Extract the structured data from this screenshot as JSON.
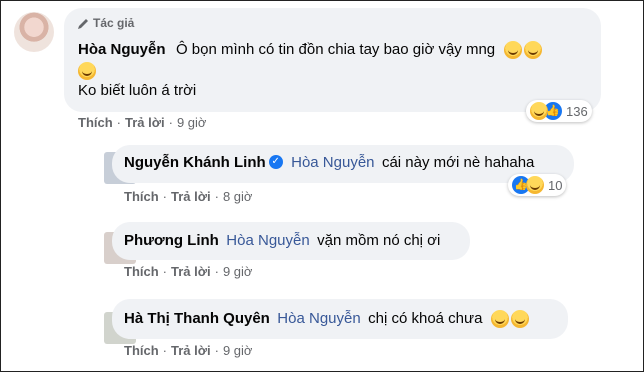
{
  "main_comment": {
    "badge": "Tác giả",
    "author": "Hòa Nguyễn",
    "text_line1": "Ô bọn mình có tin đồn chia tay bao giờ vậy mng",
    "text_line2": "Ko biết luôn á trời",
    "reaction_count": "136",
    "actions": {
      "like": "Thích",
      "reply": "Trả lời",
      "time": "9 giờ"
    }
  },
  "replies": [
    {
      "author": "Nguyễn Khánh Linh",
      "verified": true,
      "mention": "Hòa Nguyễn",
      "text": "cái này mới nè hahaha",
      "reaction_count": "10",
      "actions": {
        "like": "Thích",
        "reply": "Trả lời",
        "time": "8 giờ"
      }
    },
    {
      "author": "Phương Linh",
      "verified": false,
      "mention": "Hòa Nguyễn",
      "text": "vặn mồm nó chị ơi",
      "reaction_count": "",
      "actions": {
        "like": "Thích",
        "reply": "Trả lời",
        "time": "9 giờ"
      }
    },
    {
      "author": "Hà Thị Thanh Quyên",
      "verified": false,
      "mention": "Hòa Nguyễn",
      "text": "chị có khoá chưa",
      "reaction_count": "",
      "actions": {
        "like": "Thích",
        "reply": "Trả lời",
        "time": "9 giờ"
      }
    }
  ],
  "colors": {
    "mention": "#385898",
    "bubble": "#f0f2f5",
    "like_blue": "#1877f2",
    "meta": "#65676b"
  }
}
